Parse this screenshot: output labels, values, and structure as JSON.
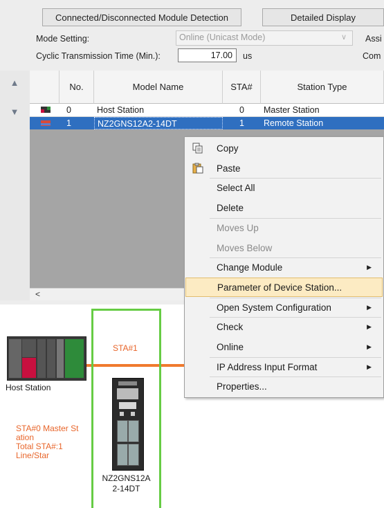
{
  "toolbar": {
    "detect_button": "Connected/Disconnected Module Detection",
    "detail_button": "Detailed Display"
  },
  "settings": {
    "mode_label": "Mode Setting:",
    "mode_value": "Online (Unicast Mode)",
    "assign_label_partial": "Assi",
    "cyclic_label": "Cyclic Transmission Time (Min.):",
    "cyclic_value": "17.00",
    "cyclic_unit": "us",
    "comm_label_partial": "Com"
  },
  "grid": {
    "headers": [
      "No.",
      "Model Name",
      "STA#",
      "Station Type"
    ],
    "rows": [
      {
        "no": "0",
        "model": "Host Station",
        "sta": "0",
        "type": "Master Station"
      },
      {
        "no": "1",
        "model": "NZ2GNS12A2-14DT",
        "sta": "1",
        "type": "Remote Station"
      }
    ],
    "scroll_left": "<"
  },
  "context_menu": {
    "items": [
      {
        "label": "Copy",
        "icon": "copy-icon",
        "enabled": true,
        "submenu": false
      },
      {
        "label": "Paste",
        "icon": "paste-icon",
        "enabled": true,
        "submenu": false
      },
      {
        "label": "Select All",
        "enabled": true,
        "submenu": false
      },
      {
        "label": "Delete",
        "enabled": true,
        "submenu": false
      },
      {
        "label": "Moves Up",
        "enabled": false,
        "submenu": false
      },
      {
        "label": "Moves Below",
        "enabled": false,
        "submenu": false
      },
      {
        "label": "Change Module",
        "enabled": true,
        "submenu": true
      },
      {
        "label": "Parameter of Device Station...",
        "enabled": true,
        "submenu": false,
        "highlighted": true
      },
      {
        "label": "Open System Configuration",
        "enabled": true,
        "submenu": true
      },
      {
        "label": "Check",
        "enabled": true,
        "submenu": true
      },
      {
        "label": "Online",
        "enabled": true,
        "submenu": true
      },
      {
        "label": "IP Address Input Format",
        "enabled": true,
        "submenu": true
      },
      {
        "label": "Properties...",
        "enabled": true,
        "submenu": false
      }
    ],
    "submenu_arrow": "▶"
  },
  "diagram": {
    "host_label": "Host Station",
    "sta1_label": "STA#1",
    "info_line1": "STA#0  Master St",
    "info_line2": "ation",
    "info_line3": "Total STA#:1",
    "info_line4": "Line/Star",
    "device_label_line1": "NZ2GNS12A",
    "device_label_line2": "2-14DT"
  },
  "colors": {
    "selection": "#2f6fc0",
    "menu_highlight": "#fcebc3",
    "accent_orange": "#e8652a",
    "device_frame_green": "#66cc44"
  }
}
